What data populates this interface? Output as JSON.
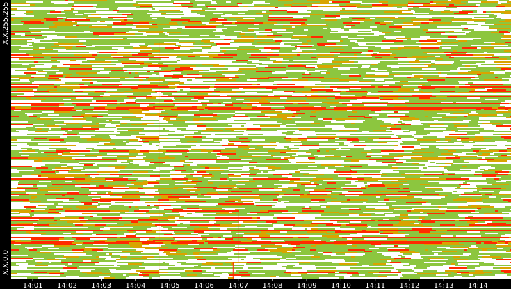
{
  "chart_data": {
    "type": "heatmap",
    "title": "",
    "xlabel": "",
    "ylabel": "",
    "x_ticks": [
      "14:01",
      "14:02",
      "14:03",
      "14:04",
      "14:05",
      "14:06",
      "14:07",
      "14:08",
      "14:09",
      "14:10",
      "14:11",
      "14:12",
      "14:13",
      "14:14"
    ],
    "x_range": [
      "14:00:22",
      "14:14:58"
    ],
    "y_labels": {
      "top": "X.X.255.255",
      "bottom": "X.X.0.0"
    },
    "y_range": [
      "X.X.0.0",
      "X.X.255.255"
    ],
    "background_color": "#ffffff",
    "palette": [
      {
        "level": "low",
        "color": "#8cc63f"
      },
      {
        "level": "medium",
        "color": "#d9a400"
      },
      {
        "level": "high",
        "color": "#ff2a00"
      }
    ],
    "event_markers": [
      {
        "time": "14:04:41",
        "y_from_fraction": 0.0,
        "y_to_fraction": 0.85,
        "color": "#ff2a00"
      },
      {
        "time": "14:06:51",
        "y_from_fraction": 0.0,
        "y_to_fraction": 0.06,
        "color": "#ff2a00"
      },
      {
        "time": "14:07:00",
        "y_from_fraction": 0.06,
        "y_to_fraction": 0.24,
        "color": "#ff2a00"
      }
    ],
    "grid": false,
    "legend": "none"
  }
}
